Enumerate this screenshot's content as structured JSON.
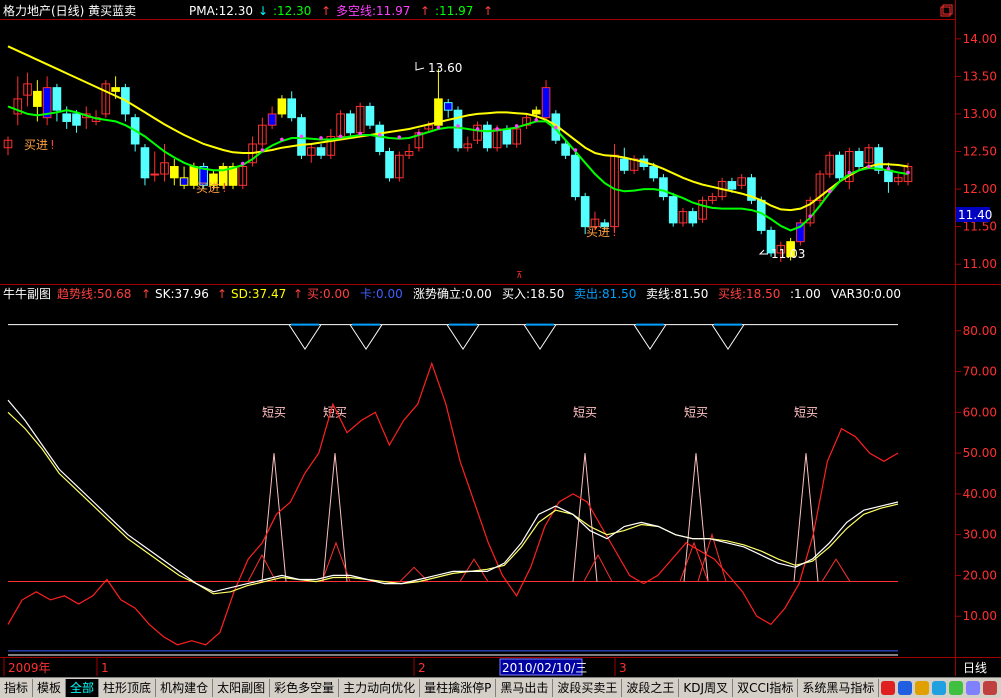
{
  "window": {
    "stock_title": "格力地产(日线) 黄买蓝卖",
    "restore_icon": "restore-icon"
  },
  "main_panel": {
    "legend": [
      {
        "text": "PMA:12.30",
        "color": "#ffffff"
      },
      {
        "text": "↓",
        "color": "#00ffff"
      },
      {
        "text": ":12.30",
        "color": "#00ff00"
      },
      {
        "text": "↑",
        "color": "#ff4040"
      },
      {
        "text": "多空线:11.97",
        "color": "#ff40ff"
      },
      {
        "text": "↑",
        "color": "#ff4040"
      },
      {
        "text": ":11.97",
        "color": "#00ff00"
      },
      {
        "text": "↑",
        "color": "#ff4040"
      }
    ],
    "price_ticks": [
      "14.00",
      "13.50",
      "13.00",
      "12.50",
      "12.00",
      "11.50",
      "11.00"
    ],
    "current_price": "11.40",
    "high_label": "13.60",
    "low_label": "11.03",
    "buy_labels": [
      "买进",
      "买进",
      "买进"
    ]
  },
  "sub_panel": {
    "legend": [
      {
        "text": "牛牛副图",
        "color": "#ffffff"
      },
      {
        "text": "趋势线:50.68",
        "color": "#ff4040"
      },
      {
        "text": "↑",
        "color": "#ff4040"
      },
      {
        "text": "SK:37.96",
        "color": "#ffffff"
      },
      {
        "text": "↑",
        "color": "#ff4040"
      },
      {
        "text": "SD:37.47",
        "color": "#ffff00"
      },
      {
        "text": "↑",
        "color": "#ff4040"
      },
      {
        "text": "买:0.00",
        "color": "#ff4040"
      },
      {
        "text": "卡:0.00",
        "color": "#4060ff"
      },
      {
        "text": "涨势确立:0.00",
        "color": "#ffffff"
      },
      {
        "text": "买入:18.50",
        "color": "#ffffff"
      },
      {
        "text": "卖出:81.50",
        "color": "#00a0ff"
      },
      {
        "text": "卖线:81.50",
        "color": "#ffffff"
      },
      {
        "text": "买线:18.50",
        "color": "#ff4040"
      },
      {
        "text": ":1.00",
        "color": "#ffffff"
      },
      {
        "text": "VAR30:0.00",
        "color": "#ffffff"
      }
    ],
    "ticks": [
      "80.00",
      "70.00",
      "60.00",
      "50.00",
      "40.00",
      "30.00",
      "20.00",
      "10.00"
    ],
    "short_buy_label": "短买"
  },
  "time_axis": {
    "labels": [
      "2009年",
      "1",
      "2",
      "3"
    ],
    "highlight": "2010/02/10/三",
    "period": "日线"
  },
  "tabs": [
    "指标",
    "模板",
    "全部",
    "柱形顶底",
    "机构建仓",
    "太阳副图",
    "彩色多空量",
    "主力动向优化",
    "量柱擒涨停P",
    "黑马出击",
    "波段买卖王",
    "波段之王",
    "KDJ周叉",
    "双CCI指标",
    "系统黑马指标"
  ],
  "active_tab": "全部",
  "colors": {
    "up": "#ff3030",
    "down": "#54ffff",
    "buy_candle": "#ffff00",
    "sell_candle": "#0000ff",
    "ma_yellow": "#ffff00",
    "ma_green": "#00ff00",
    "trend": "#ff2020",
    "sk": "#ffffff",
    "sd": "#ffff66",
    "grid": "#a00000"
  },
  "chart_data": [
    {
      "type": "candlestick",
      "title": "格力地产(日线) 黄买蓝卖",
      "ylim": [
        10.75,
        14.25
      ],
      "candles": [
        {
          "o": 12.55,
          "c": 12.65,
          "h": 12.7,
          "l": 12.45
        },
        {
          "o": 13.0,
          "c": 13.2,
          "h": 13.5,
          "l": 12.85
        },
        {
          "o": 13.25,
          "c": 13.4,
          "h": 13.55,
          "l": 13.1
        },
        {
          "o": 13.3,
          "c": 13.1,
          "h": 13.45,
          "l": 12.9
        },
        {
          "o": 12.95,
          "c": 13.35,
          "h": 13.5,
          "l": 12.85
        },
        {
          "o": 13.35,
          "c": 13.05,
          "h": 13.4,
          "l": 12.9
        },
        {
          "o": 13.0,
          "c": 12.9,
          "h": 13.1,
          "l": 12.8
        },
        {
          "o": 13.0,
          "c": 12.85,
          "h": 13.05,
          "l": 12.75
        },
        {
          "o": 12.95,
          "c": 13.0,
          "h": 13.1,
          "l": 12.8
        },
        {
          "o": 12.9,
          "c": 12.95,
          "h": 13.05,
          "l": 12.85
        },
        {
          "o": 13.0,
          "c": 13.4,
          "h": 13.45,
          "l": 12.95
        },
        {
          "o": 13.3,
          "c": 13.35,
          "h": 13.5,
          "l": 13.2
        },
        {
          "o": 13.35,
          "c": 13.0,
          "h": 13.4,
          "l": 12.9
        },
        {
          "o": 12.95,
          "c": 12.6,
          "h": 13.0,
          "l": 12.5
        },
        {
          "o": 12.55,
          "c": 12.15,
          "h": 12.6,
          "l": 12.05
        },
        {
          "o": 12.2,
          "c": 12.2,
          "h": 12.5,
          "l": 12.1
        },
        {
          "o": 12.2,
          "c": 12.35,
          "h": 12.6,
          "l": 12.1
        },
        {
          "o": 12.3,
          "c": 12.15,
          "h": 12.4,
          "l": 12.05
        },
        {
          "o": 12.15,
          "c": 12.05,
          "h": 12.3,
          "l": 12.0
        },
        {
          "o": 12.05,
          "c": 12.3,
          "h": 12.35,
          "l": 12.0
        },
        {
          "o": 12.3,
          "c": 12.05,
          "h": 12.35,
          "l": 12.0
        },
        {
          "o": 12.05,
          "c": 12.2,
          "h": 12.25,
          "l": 12.0
        },
        {
          "o": 12.05,
          "c": 12.3,
          "h": 12.35,
          "l": 12.0
        },
        {
          "o": 12.3,
          "c": 12.05,
          "h": 12.35,
          "l": 12.0
        },
        {
          "o": 12.05,
          "c": 12.3,
          "h": 12.35,
          "l": 12.0
        },
        {
          "o": 12.35,
          "c": 12.6,
          "h": 12.7,
          "l": 12.3
        },
        {
          "o": 12.6,
          "c": 12.85,
          "h": 12.95,
          "l": 12.55
        },
        {
          "o": 12.85,
          "c": 13.0,
          "h": 13.1,
          "l": 12.8
        },
        {
          "o": 13.0,
          "c": 13.2,
          "h": 13.25,
          "l": 12.95
        },
        {
          "o": 13.2,
          "c": 12.95,
          "h": 13.3,
          "l": 12.9
        },
        {
          "o": 12.95,
          "c": 12.45,
          "h": 13.0,
          "l": 12.4
        },
        {
          "o": 12.45,
          "c": 12.55,
          "h": 12.6,
          "l": 12.35
        },
        {
          "o": 12.55,
          "c": 12.45,
          "h": 12.6,
          "l": 12.4
        },
        {
          "o": 12.45,
          "c": 12.7,
          "h": 12.8,
          "l": 12.4
        },
        {
          "o": 12.7,
          "c": 13.0,
          "h": 13.05,
          "l": 12.65
        },
        {
          "o": 13.0,
          "c": 12.75,
          "h": 13.05,
          "l": 12.7
        },
        {
          "o": 12.75,
          "c": 13.1,
          "h": 13.15,
          "l": 12.7
        },
        {
          "o": 13.1,
          "c": 12.85,
          "h": 13.15,
          "l": 12.8
        },
        {
          "o": 12.85,
          "c": 12.5,
          "h": 12.9,
          "l": 12.45
        },
        {
          "o": 12.5,
          "c": 12.15,
          "h": 12.55,
          "l": 12.1
        },
        {
          "o": 12.15,
          "c": 12.45,
          "h": 12.5,
          "l": 12.1
        },
        {
          "o": 12.45,
          "c": 12.5,
          "h": 12.6,
          "l": 12.4
        },
        {
          "o": 12.55,
          "c": 12.75,
          "h": 12.8,
          "l": 12.5
        },
        {
          "o": 12.8,
          "c": 12.85,
          "h": 12.9,
          "l": 12.75
        },
        {
          "o": 12.85,
          "c": 13.2,
          "h": 13.6,
          "l": 12.8
        },
        {
          "o": 13.15,
          "c": 13.05,
          "h": 13.2,
          "l": 12.95
        },
        {
          "o": 13.05,
          "c": 12.55,
          "h": 13.1,
          "l": 12.5
        },
        {
          "o": 12.55,
          "c": 12.6,
          "h": 12.7,
          "l": 12.5
        },
        {
          "o": 12.65,
          "c": 12.85,
          "h": 12.9,
          "l": 12.6
        },
        {
          "o": 12.85,
          "c": 12.55,
          "h": 12.9,
          "l": 12.5
        },
        {
          "o": 12.55,
          "c": 12.8,
          "h": 12.85,
          "l": 12.5
        },
        {
          "o": 12.8,
          "c": 12.6,
          "h": 12.85,
          "l": 12.55
        },
        {
          "o": 12.6,
          "c": 12.8,
          "h": 12.85,
          "l": 12.55
        },
        {
          "o": 12.85,
          "c": 12.95,
          "h": 13.0,
          "l": 12.8
        },
        {
          "o": 13.0,
          "c": 13.05,
          "h": 13.1,
          "l": 12.9
        },
        {
          "o": 12.95,
          "c": 13.35,
          "h": 13.45,
          "l": 12.9
        },
        {
          "o": 13.0,
          "c": 12.65,
          "h": 13.05,
          "l": 12.6
        },
        {
          "o": 12.6,
          "c": 12.45,
          "h": 12.65,
          "l": 12.4
        },
        {
          "o": 12.45,
          "c": 11.9,
          "h": 12.5,
          "l": 11.85
        },
        {
          "o": 11.9,
          "c": 11.5,
          "h": 11.95,
          "l": 11.4
        },
        {
          "o": 11.5,
          "c": 11.6,
          "h": 11.7,
          "l": 11.45
        },
        {
          "o": 11.55,
          "c": 11.5,
          "h": 11.6,
          "l": 11.45
        },
        {
          "o": 11.5,
          "c": 12.45,
          "h": 12.6,
          "l": 11.45
        },
        {
          "o": 12.4,
          "c": 12.25,
          "h": 12.55,
          "l": 12.2
        },
        {
          "o": 12.25,
          "c": 12.4,
          "h": 12.45,
          "l": 12.2
        },
        {
          "o": 12.4,
          "c": 12.3,
          "h": 12.45,
          "l": 12.25
        },
        {
          "o": 12.3,
          "c": 12.15,
          "h": 12.35,
          "l": 12.1
        },
        {
          "o": 12.15,
          "c": 11.9,
          "h": 12.2,
          "l": 11.85
        },
        {
          "o": 11.9,
          "c": 11.55,
          "h": 11.95,
          "l": 11.5
        },
        {
          "o": 11.55,
          "c": 11.7,
          "h": 11.75,
          "l": 11.5
        },
        {
          "o": 11.7,
          "c": 11.55,
          "h": 11.75,
          "l": 11.5
        },
        {
          "o": 11.6,
          "c": 11.85,
          "h": 11.9,
          "l": 11.55
        },
        {
          "o": 11.85,
          "c": 11.9,
          "h": 11.95,
          "l": 11.8
        },
        {
          "o": 11.9,
          "c": 12.1,
          "h": 12.15,
          "l": 11.85
        },
        {
          "o": 12.1,
          "c": 12.0,
          "h": 12.15,
          "l": 11.95
        },
        {
          "o": 12.05,
          "c": 12.15,
          "h": 12.2,
          "l": 12.0
        },
        {
          "o": 12.15,
          "c": 11.85,
          "h": 12.2,
          "l": 11.8
        },
        {
          "o": 11.85,
          "c": 11.45,
          "h": 11.9,
          "l": 11.4
        },
        {
          "o": 11.45,
          "c": 11.15,
          "h": 11.5,
          "l": 11.1
        },
        {
          "o": 11.15,
          "c": 11.25,
          "h": 11.3,
          "l": 11.03
        },
        {
          "o": 11.1,
          "c": 11.3,
          "h": 11.35,
          "l": 11.05
        },
        {
          "o": 11.3,
          "c": 11.55,
          "h": 11.6,
          "l": 11.25
        },
        {
          "o": 11.55,
          "c": 11.85,
          "h": 11.9,
          "l": 11.5
        },
        {
          "o": 11.85,
          "c": 12.2,
          "h": 12.25,
          "l": 11.8
        },
        {
          "o": 12.2,
          "c": 12.45,
          "h": 12.5,
          "l": 12.15
        },
        {
          "o": 12.45,
          "c": 12.15,
          "h": 12.5,
          "l": 12.1
        },
        {
          "o": 12.1,
          "c": 12.5,
          "h": 12.55,
          "l": 12.0
        },
        {
          "o": 12.5,
          "c": 12.3,
          "h": 12.55,
          "l": 12.25
        },
        {
          "o": 12.35,
          "c": 12.55,
          "h": 12.6,
          "l": 12.3
        },
        {
          "o": 12.55,
          "c": 12.25,
          "h": 12.6,
          "l": 12.2
        },
        {
          "o": 12.25,
          "c": 12.1,
          "h": 12.35,
          "l": 11.95
        },
        {
          "o": 12.1,
          "c": 12.15,
          "h": 12.2,
          "l": 12.05
        },
        {
          "o": 12.1,
          "c": 12.3,
          "h": 12.35,
          "l": 12.05
        }
      ],
      "ma_yellow": [
        13.9,
        13.84,
        13.78,
        13.72,
        13.66,
        13.6,
        13.54,
        13.48,
        13.42,
        13.36,
        13.3,
        13.24,
        13.18,
        13.1,
        13.02,
        12.94,
        12.86,
        12.79,
        12.72,
        12.66,
        12.6,
        12.56,
        12.52,
        12.49,
        12.48,
        12.48,
        12.5,
        12.52,
        12.55,
        12.57,
        12.59,
        12.6,
        12.62,
        12.64,
        12.66,
        12.68,
        12.7,
        12.72,
        12.74,
        12.76,
        12.78,
        12.8,
        12.83,
        12.86,
        12.89,
        12.92,
        12.95,
        12.98,
        13.0,
        13.01,
        13.02,
        13.02,
        13.01,
        13.0,
        12.97,
        12.92,
        12.85,
        12.75,
        12.65,
        12.55,
        12.48,
        12.45,
        12.44,
        12.42,
        12.39,
        12.36,
        12.32,
        12.27,
        12.21,
        12.15,
        12.1,
        12.06,
        12.03,
        12.0,
        11.97,
        11.94,
        11.9,
        11.85,
        11.78,
        11.73,
        11.72,
        11.74,
        11.8,
        11.9,
        12.0,
        12.1,
        12.18,
        12.25,
        12.3,
        12.33,
        12.33,
        12.32,
        12.3
      ],
      "ma_green": [
        13.1,
        13.05,
        13.0,
        12.98,
        13.0,
        13.02,
        13.05,
        13.02,
        12.98,
        12.94,
        12.92,
        12.9,
        12.85,
        12.78,
        12.7,
        12.6,
        12.5,
        12.42,
        12.35,
        12.3,
        12.27,
        12.25,
        12.25,
        12.28,
        12.32,
        12.4,
        12.5,
        12.58,
        12.64,
        12.68,
        12.68,
        12.67,
        12.66,
        12.66,
        12.68,
        12.7,
        12.72,
        12.72,
        12.7,
        12.68,
        12.67,
        12.68,
        12.72,
        12.76,
        12.8,
        12.82,
        12.82,
        12.8,
        12.78,
        12.77,
        12.78,
        12.8,
        12.82,
        12.86,
        12.9,
        12.9,
        12.8,
        12.65,
        12.5,
        12.35,
        12.2,
        12.08,
        12.0,
        11.97,
        11.98,
        12.0,
        12.0,
        11.98,
        11.93,
        11.88,
        11.82,
        11.78,
        11.75,
        11.74,
        11.74,
        11.74,
        11.72,
        11.68,
        11.6,
        11.51,
        11.45,
        11.5,
        11.62,
        11.78,
        11.95,
        12.1,
        12.2,
        12.25,
        12.28,
        12.27,
        12.25,
        12.22,
        12.2
      ]
    },
    {
      "type": "line",
      "title": "牛牛副图",
      "ylim": [
        0,
        90
      ],
      "series": [
        {
          "name": "趋势线",
          "values": [
            8,
            14,
            16,
            14,
            15,
            13,
            15,
            19,
            14,
            12,
            8,
            5,
            3,
            4,
            3,
            6,
            16,
            24,
            28,
            35,
            38,
            45,
            50,
            62,
            55,
            58,
            60,
            52,
            58,
            62,
            72,
            62,
            48,
            38,
            28,
            20,
            15,
            22,
            32,
            38,
            40,
            38,
            32,
            26,
            20,
            18,
            20,
            24,
            28,
            26,
            24,
            20,
            16,
            10,
            8,
            12,
            18,
            30,
            48,
            56,
            54,
            50,
            48,
            50
          ]
        },
        {
          "name": "SK",
          "values": [
            63,
            58,
            52,
            46,
            42,
            38,
            34,
            30,
            27,
            24,
            21,
            18,
            16,
            17,
            18,
            19,
            20,
            19,
            19,
            20,
            20,
            19,
            18,
            18,
            19,
            20,
            21,
            21,
            21,
            23,
            28,
            35,
            37,
            35,
            31,
            29,
            32,
            33,
            32,
            30,
            29,
            29,
            28,
            27,
            25,
            23,
            22,
            24,
            28,
            33,
            36,
            37,
            38
          ]
        },
        {
          "name": "SD",
          "values": [
            60,
            56,
            51,
            45,
            41,
            37,
            33,
            29,
            26,
            23,
            20,
            18,
            15.5,
            16,
            17.5,
            18.5,
            19.5,
            19,
            18.5,
            19.5,
            19.5,
            19,
            18.5,
            18,
            18.5,
            19.5,
            20.5,
            21,
            21.5,
            22.5,
            27,
            33,
            36,
            35,
            32,
            30,
            31,
            32.5,
            32,
            30,
            29,
            29,
            28.5,
            27.5,
            26,
            24,
            22.5,
            23.5,
            27,
            31.5,
            35,
            36.5,
            37.5
          ]
        }
      ]
    }
  ]
}
